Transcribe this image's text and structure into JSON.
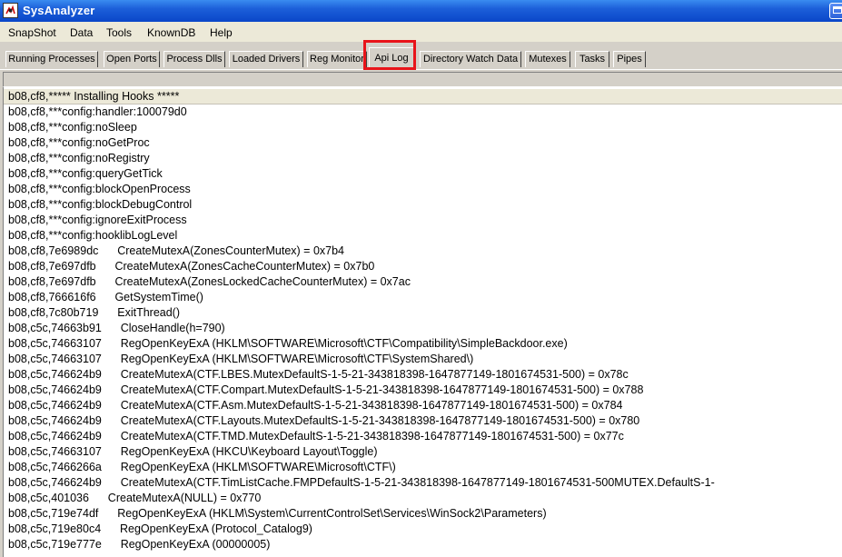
{
  "window": {
    "title": "SysAnalyzer",
    "colors": {
      "titlebar": "#0a46c8",
      "highlight": "#e8141a"
    }
  },
  "menu": [
    "SnapShot",
    "Data",
    "Tools",
    "KnownDB",
    "Help"
  ],
  "tabs": [
    {
      "label": "Running Processes"
    },
    {
      "label": "Open Ports"
    },
    {
      "label": "Process Dlls"
    },
    {
      "label": "Loaded Drivers"
    },
    {
      "label": "Reg Monitor"
    },
    {
      "label": "Api Log",
      "active": true
    },
    {
      "label": "Directory Watch Data"
    },
    {
      "label": "Mutexes"
    },
    {
      "label": "Tasks"
    },
    {
      "label": "Pipes"
    }
  ],
  "log_rows": [
    "b08,cf8,***** Installing Hooks *****",
    "b08,cf8,***config:handler:100079d0",
    "b08,cf8,***config:noSleep",
    "b08,cf8,***config:noGetProc",
    "b08,cf8,***config:noRegistry",
    "b08,cf8,***config:queryGetTick",
    "b08,cf8,***config:blockOpenProcess",
    "b08,cf8,***config:blockDebugControl",
    "b08,cf8,***config:ignoreExitProcess",
    "b08,cf8,***config:hooklibLogLevel",
    "b08,cf8,7e6989dc      CreateMutexA(ZonesCounterMutex) = 0x7b4",
    "b08,cf8,7e697dfb      CreateMutexA(ZonesCacheCounterMutex) = 0x7b0",
    "b08,cf8,7e697dfb      CreateMutexA(ZonesLockedCacheCounterMutex) = 0x7ac",
    "b08,cf8,766616f6      GetSystemTime()",
    "b08,cf8,7c80b719      ExitThread()",
    "b08,c5c,74663b91      CloseHandle(h=790)",
    "b08,c5c,74663107      RegOpenKeyExA (HKLM\\SOFTWARE\\Microsoft\\CTF\\Compatibility\\SimpleBackdoor.exe)",
    "b08,c5c,74663107      RegOpenKeyExA (HKLM\\SOFTWARE\\Microsoft\\CTF\\SystemShared\\)",
    "b08,c5c,746624b9      CreateMutexA(CTF.LBES.MutexDefaultS-1-5-21-343818398-1647877149-1801674531-500) = 0x78c",
    "b08,c5c,746624b9      CreateMutexA(CTF.Compart.MutexDefaultS-1-5-21-343818398-1647877149-1801674531-500) = 0x788",
    "b08,c5c,746624b9      CreateMutexA(CTF.Asm.MutexDefaultS-1-5-21-343818398-1647877149-1801674531-500) = 0x784",
    "b08,c5c,746624b9      CreateMutexA(CTF.Layouts.MutexDefaultS-1-5-21-343818398-1647877149-1801674531-500) = 0x780",
    "b08,c5c,746624b9      CreateMutexA(CTF.TMD.MutexDefaultS-1-5-21-343818398-1647877149-1801674531-500) = 0x77c",
    "b08,c5c,74663107      RegOpenKeyExA (HKCU\\Keyboard Layout\\Toggle)",
    "b08,c5c,7466266a      RegOpenKeyExA (HKLM\\SOFTWARE\\Microsoft\\CTF\\)",
    "b08,c5c,746624b9      CreateMutexA(CTF.TimListCache.FMPDefaultS-1-5-21-343818398-1647877149-1801674531-500MUTEX.DefaultS-1-",
    "b08,c5c,401036      CreateMutexA(NULL) = 0x770",
    "b08,c5c,719e74df      RegOpenKeyExA (HKLM\\System\\CurrentControlSet\\Services\\WinSock2\\Parameters)",
    "b08,c5c,719e80c4      RegOpenKeyExA (Protocol_Catalog9)",
    "b08,c5c,719e777e      RegOpenKeyExA (00000005)"
  ]
}
